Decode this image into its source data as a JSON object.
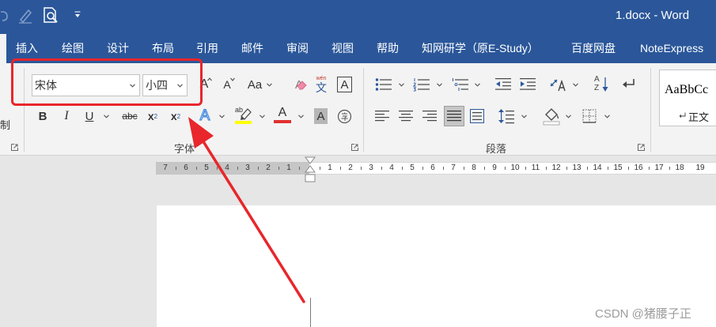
{
  "window": {
    "title": "1.docx - Word"
  },
  "quick_access": {
    "icons": [
      "redo-icon",
      "pen-icon",
      "print-preview-icon",
      "customize-toolbar-icon"
    ]
  },
  "tabs": [
    {
      "label": "插入"
    },
    {
      "label": "绘图"
    },
    {
      "label": "设计"
    },
    {
      "label": "布局"
    },
    {
      "label": "引用"
    },
    {
      "label": "邮件"
    },
    {
      "label": "审阅"
    },
    {
      "label": "视图"
    },
    {
      "label": "帮助"
    },
    {
      "label": "知网研学（原E-Study）"
    },
    {
      "label": "百度网盘"
    },
    {
      "label": "NoteExpress"
    }
  ],
  "clipboard_group": {
    "partial_label": "制"
  },
  "font_group": {
    "label": "字体",
    "font_name": "宋体",
    "font_size": "小四",
    "grow_font": "A",
    "shrink_font": "A",
    "change_case": "Aa",
    "clear_format": "A",
    "phonetic_top": "wén",
    "phonetic_char": "文",
    "char_border": "A",
    "bold": "B",
    "italic": "I",
    "underline": "U",
    "strike": "abc",
    "subscript": {
      "base": "x",
      "sub": "2"
    },
    "superscript": {
      "base": "x",
      "sup": "2"
    },
    "text_effects": "A",
    "highlight": "ab",
    "font_color": "A",
    "char_shading": "A"
  },
  "paragraph_group": {
    "label": "段落",
    "sort_letters": {
      "top": "A",
      "bottom": "Z"
    },
    "icons": [
      "bullets-icon",
      "numbering-icon",
      "multilevel-list-icon",
      "decrease-indent-icon",
      "increase-indent-icon",
      "asian-layout-icon",
      "sort-icon",
      "show-marks-icon",
      "align-left-icon",
      "align-center-icon",
      "align-right-icon",
      "justify-icon",
      "distributed-icon",
      "line-spacing-icon",
      "shading-icon",
      "borders-icon"
    ],
    "selected_alignment": "justify"
  },
  "styles": {
    "preview": "AaBbCc",
    "name": "正文"
  },
  "ruler": {
    "left_numbers": [
      "7",
      "6",
      "5",
      "4",
      "3",
      "2",
      "1"
    ],
    "right_numbers": [
      "1",
      "2",
      "3",
      "4",
      "5",
      "6",
      "7",
      "8",
      "9",
      "10",
      "11",
      "12",
      "13",
      "14",
      "15",
      "16",
      "17",
      "18",
      "19"
    ]
  },
  "watermark": "CSDN @猪腰子正",
  "colors": {
    "title_bar": "#2b579a",
    "ribbon": "#f3f3f3",
    "annotation_red": "#e8262b",
    "font_color_bar": "#e03030",
    "highlight_bar": "#ffff00"
  }
}
